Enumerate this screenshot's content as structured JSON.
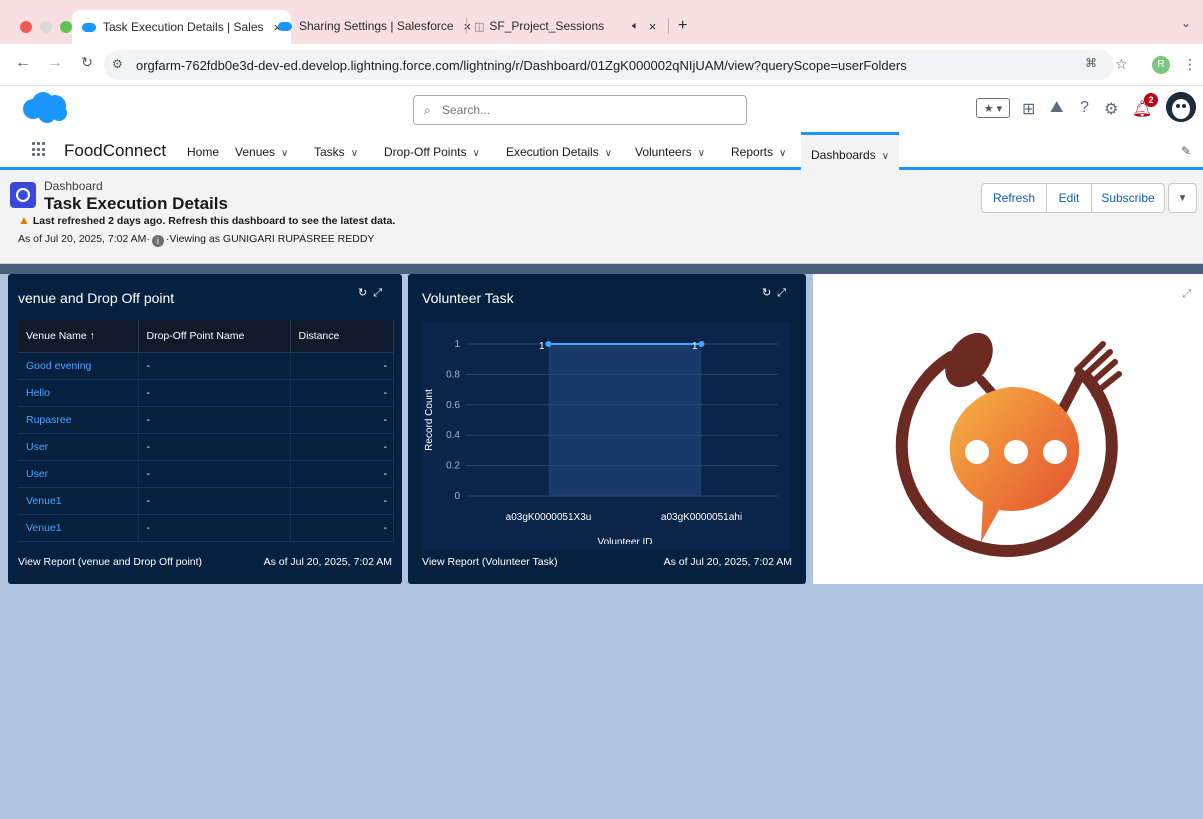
{
  "browser": {
    "tabs": [
      {
        "title": "Task Execution Details | Sales",
        "close": "×"
      },
      {
        "title": "Sharing Settings | Salesforce",
        "close": "×"
      },
      {
        "title": "SF_Project_Sessions",
        "close": "×"
      }
    ],
    "new_tab": "+",
    "url": "orgfarm-762fdb0e3d-dev-ed.develop.lightning.force.com/lightning/r/Dashboard/01ZgK000002qNIjUAM/view?queryScope=userFolders",
    "profile_initial": "R"
  },
  "header": {
    "search_placeholder": "Search...",
    "notification_count": "2"
  },
  "nav": {
    "app_name": "FoodConnect",
    "items": [
      {
        "label": "Home"
      },
      {
        "label": "Venues"
      },
      {
        "label": "Tasks"
      },
      {
        "label": "Drop-Off Points"
      },
      {
        "label": "Execution Details"
      },
      {
        "label": "Volunteers"
      },
      {
        "label": "Reports"
      },
      {
        "label": "Dashboards"
      }
    ]
  },
  "dashboard": {
    "type_label": "Dashboard",
    "title": "Task Execution Details",
    "warning": "Last refreshed 2 days ago. Refresh this dashboard to see the latest data.",
    "as_of": "As of Jul 20, 2025, 7:02 AM·",
    "viewing_as": "·Viewing as GUNIGARI RUPASREE REDDY",
    "buttons": {
      "refresh": "Refresh",
      "edit": "Edit",
      "subscribe": "Subscribe"
    }
  },
  "table_widget": {
    "title": "venue and Drop Off point",
    "columns": [
      "Venue Name ↑",
      "Drop-Off Point Name",
      "Distance"
    ],
    "rows": [
      [
        "Good evening",
        "-",
        "-"
      ],
      [
        "Hello",
        "-",
        "-"
      ],
      [
        "Rupasree",
        "-",
        "-"
      ],
      [
        "User",
        "-",
        "-"
      ],
      [
        "User",
        "-",
        "-"
      ],
      [
        "Venue1",
        "-",
        "-"
      ],
      [
        "Venue1",
        "-",
        "-"
      ]
    ],
    "footer_link": "View Report (venue and Drop Off point)",
    "footer_asof": "As of Jul 20, 2025, 7:02 AM"
  },
  "chart_widget": {
    "title": "Volunteer Task",
    "footer_link": "View Report (Volunteer Task)",
    "footer_asof": "As of Jul 20, 2025, 7:02 AM"
  },
  "chart_data": {
    "type": "line",
    "categories": [
      "a03gK0000051X3u",
      "a03gK0000051ahi"
    ],
    "series": [
      {
        "values": [
          1,
          1
        ]
      }
    ],
    "data_labels": [
      "1",
      "1"
    ],
    "xlabel": "Volunteer ID",
    "ylabel": "Record Count",
    "yticks": [
      "0",
      "0.2",
      "0.4",
      "0.6",
      "0.8",
      "1"
    ],
    "ylim": [
      0,
      1
    ],
    "grid": true,
    "line_color": "#4aa3ff"
  },
  "colors": {
    "brand_blue": "#1b96ff",
    "widget_dark": "#06213f",
    "canvas": "#b0c4df",
    "link": "#4ea4ff",
    "logo_orange": "#f08a3c",
    "logo_brown": "#6b2a22"
  },
  "icons": {
    "bell": "bell-icon",
    "help": "help-icon",
    "gear": "gear-icon",
    "favorites": "star-icon"
  }
}
